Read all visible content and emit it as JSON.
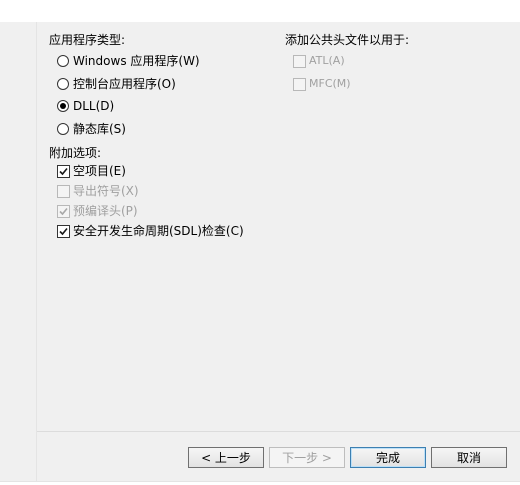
{
  "app_type": {
    "heading": "应用程序类型:",
    "options": [
      {
        "label": "Windows 应用程序(W)",
        "checked": false
      },
      {
        "label": "控制台应用程序(O)",
        "checked": false
      },
      {
        "label": "DLL(D)",
        "checked": true
      },
      {
        "label": "静态库(S)",
        "checked": false
      }
    ]
  },
  "headers": {
    "heading": "添加公共头文件以用于:",
    "options": [
      {
        "label": "ATL(A)",
        "checked": false,
        "enabled": false
      },
      {
        "label": "MFC(M)",
        "checked": false,
        "enabled": false
      }
    ]
  },
  "extra": {
    "heading": "附加选项:",
    "options": [
      {
        "label": "空项目(E)",
        "checked": true,
        "enabled": true
      },
      {
        "label": "导出符号(X)",
        "checked": false,
        "enabled": false
      },
      {
        "label": "预编译头(P)",
        "checked": true,
        "enabled": false
      },
      {
        "label": "安全开发生命周期(SDL)检查(C)",
        "checked": true,
        "enabled": true
      }
    ]
  },
  "buttons": {
    "back": "< 上一步",
    "next": "下一步 >",
    "finish": "完成",
    "cancel": "取消"
  }
}
